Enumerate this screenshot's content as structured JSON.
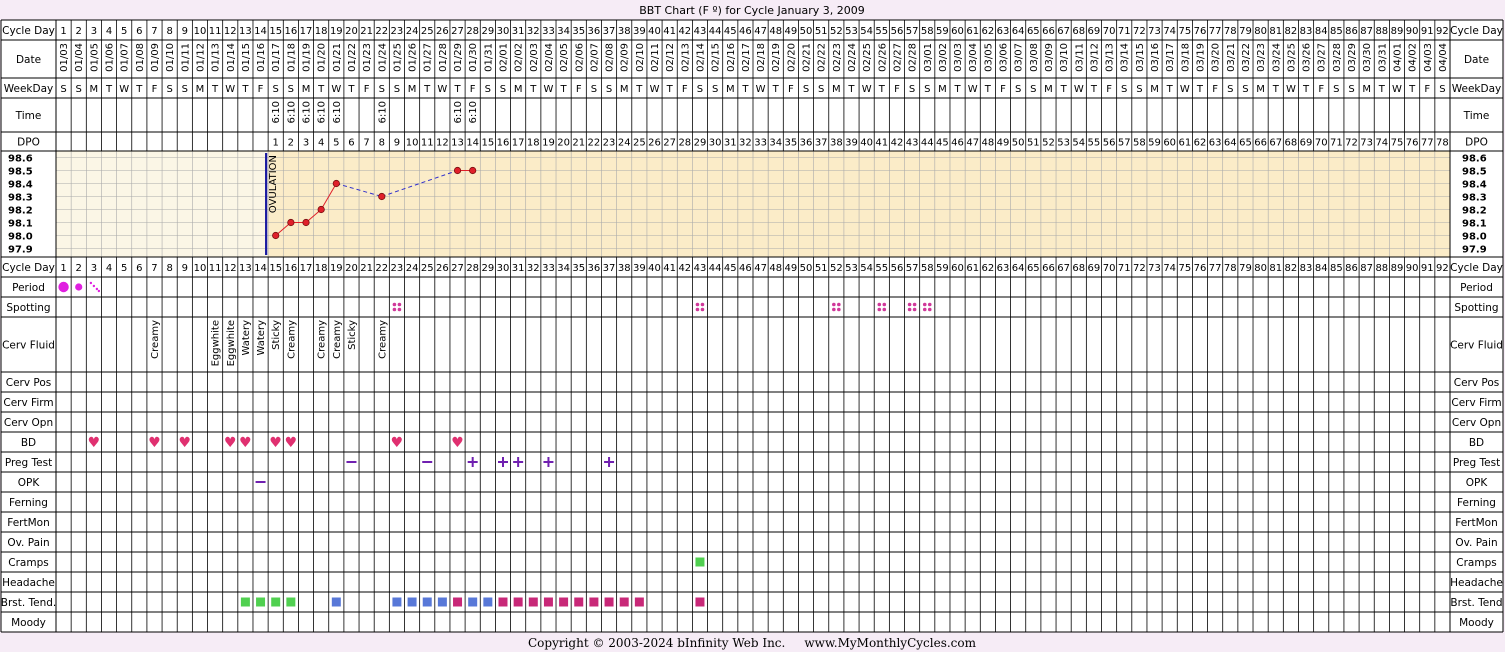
{
  "title": "BBT Chart (F º) for Cycle January 3, 2009",
  "footer": "Copyright © 2003-2024 bInfinity Web Inc.     www.MyMonthlyCycles.com",
  "colors": {
    "page_bg": "#f6ecf6",
    "chart_fill": "#fbecc8",
    "pre_ov_fill": "#fbf6e6",
    "line": "#000000",
    "grid": "#aaaaaa",
    "temp_line": "#e0202a",
    "temp_dash": "#3030cc",
    "ovulation": "#1a1aa0",
    "period": "#e020e0",
    "spotting": "#d0389a",
    "heart": "#e03070",
    "preg_test": "#7020b0",
    "cramps": "#50d050",
    "brst_green": "#50d050",
    "brst_blue": "#5878d8",
    "brst_pink": "#c82878"
  },
  "labels": {
    "cycle_day": "Cycle Day",
    "date": "Date",
    "weekday": "WeekDay",
    "time": "Time",
    "dpo": "DPO",
    "period": "Period",
    "spotting": "Spotting",
    "cerv_fluid": "Cerv Fluid",
    "cerv_pos": "Cerv Pos",
    "cerv_firm": "Cerv Firm",
    "cerv_opn": "Cerv Opn",
    "bd": "BD",
    "preg_test": "Preg Test",
    "opk": "OPK",
    "ferning": "Ferning",
    "fertmon": "FertMon",
    "ov_pain": "Ov. Pain",
    "cramps": "Cramps",
    "headache": "Headache",
    "brst_tend": "Brst. Tend.",
    "moody": "Moody",
    "brst_tend_right": "Brst. Tend",
    "ovulation": "OVULATION"
  },
  "dates": [
    "01/03",
    "01/04",
    "01/05",
    "01/06",
    "01/07",
    "01/08",
    "01/09",
    "01/10",
    "01/11",
    "01/12",
    "01/13",
    "01/14",
    "01/15",
    "01/16",
    "01/17",
    "01/18",
    "01/19",
    "01/20",
    "01/21",
    "01/22",
    "01/23",
    "01/24",
    "01/25",
    "01/26",
    "01/27",
    "01/28",
    "01/29",
    "01/30",
    "01/31",
    "02/01",
    "02/02",
    "02/03",
    "02/04",
    "02/05",
    "02/06",
    "02/07",
    "02/08",
    "02/09",
    "02/10",
    "02/11",
    "02/12",
    "02/13",
    "02/14",
    "02/15",
    "02/16",
    "02/17",
    "02/18",
    "02/19",
    "02/20",
    "02/21",
    "02/22",
    "02/23",
    "02/24",
    "02/25",
    "02/26",
    "02/27",
    "02/28",
    "03/01",
    "03/02",
    "03/03",
    "03/04",
    "03/05",
    "03/06",
    "03/07",
    "03/08",
    "03/09",
    "03/10",
    "03/11",
    "03/12",
    "03/13",
    "03/14",
    "03/15",
    "03/16",
    "03/17",
    "03/18",
    "03/19",
    "03/20",
    "03/21",
    "03/22",
    "03/23",
    "03/24",
    "03/25",
    "03/26",
    "03/27",
    "03/28",
    "03/29",
    "03/30",
    "03/31",
    "04/01",
    "04/02",
    "04/03",
    "04/04"
  ],
  "weekdays": [
    "S",
    "S",
    "M",
    "T",
    "W",
    "T",
    "F",
    "S",
    "S",
    "M",
    "T",
    "W",
    "T",
    "F",
    "S",
    "S",
    "M",
    "T",
    "W",
    "T",
    "F",
    "S",
    "S",
    "M",
    "T",
    "W",
    "T",
    "F",
    "S",
    "S",
    "M",
    "T",
    "W",
    "T",
    "F",
    "S",
    "S",
    "M",
    "T",
    "W",
    "T",
    "F",
    "S",
    "S",
    "M",
    "T",
    "W",
    "T",
    "F",
    "S",
    "S",
    "M",
    "T",
    "W",
    "T",
    "F",
    "S",
    "S",
    "M",
    "T",
    "W",
    "T",
    "F",
    "S",
    "S",
    "M",
    "T",
    "W",
    "T",
    "F",
    "S",
    "S",
    "M",
    "T",
    "W",
    "T",
    "F",
    "S",
    "S",
    "M",
    "T",
    "W",
    "T",
    "F",
    "S",
    "S",
    "M",
    "T",
    "W",
    "T",
    "F",
    "S"
  ],
  "times": [
    {
      "day": 15,
      "t": "6:10"
    },
    {
      "day": 16,
      "t": "6:10"
    },
    {
      "day": 17,
      "t": "6:10"
    },
    {
      "day": 18,
      "t": "6:10"
    },
    {
      "day": 19,
      "t": "6:10"
    },
    {
      "day": 22,
      "t": "6:10"
    },
    {
      "day": 27,
      "t": "6:10"
    },
    {
      "day": 28,
      "t": "6:10"
    }
  ],
  "dpo_start_day": 15,
  "dpo_end": 78,
  "cerv_fluid": [
    {
      "day": 7,
      "v": "Creamy"
    },
    {
      "day": 11,
      "v": "Eggwhite"
    },
    {
      "day": 12,
      "v": "Eggwhite"
    },
    {
      "day": 13,
      "v": "Watery"
    },
    {
      "day": 14,
      "v": "Watery"
    },
    {
      "day": 15,
      "v": "Sticky"
    },
    {
      "day": 16,
      "v": "Creamy"
    },
    {
      "day": 18,
      "v": "Creamy"
    },
    {
      "day": 19,
      "v": "Creamy"
    },
    {
      "day": 20,
      "v": "Sticky"
    },
    {
      "day": 22,
      "v": "Creamy"
    }
  ],
  "period": [
    {
      "day": 1,
      "level": "heavy"
    },
    {
      "day": 2,
      "level": "medium"
    },
    {
      "day": 3,
      "level": "spotting"
    }
  ],
  "spotting_days": [
    23,
    43,
    52,
    55,
    57,
    58
  ],
  "bd_days": [
    3,
    7,
    9,
    12,
    13,
    15,
    16,
    23,
    27
  ],
  "preg_tests": [
    {
      "day": 20,
      "r": "neg"
    },
    {
      "day": 25,
      "r": "neg"
    },
    {
      "day": 28,
      "r": "pos"
    },
    {
      "day": 30,
      "r": "pos"
    },
    {
      "day": 31,
      "r": "pos"
    },
    {
      "day": 33,
      "r": "pos"
    },
    {
      "day": 37,
      "r": "pos"
    }
  ],
  "opk": [
    {
      "day": 14,
      "r": "neg"
    }
  ],
  "cramps_days": [
    43
  ],
  "brst_tend": [
    {
      "day": 13,
      "c": "green"
    },
    {
      "day": 14,
      "c": "green"
    },
    {
      "day": 15,
      "c": "green"
    },
    {
      "day": 16,
      "c": "green"
    },
    {
      "day": 19,
      "c": "blue"
    },
    {
      "day": 23,
      "c": "blue"
    },
    {
      "day": 24,
      "c": "blue"
    },
    {
      "day": 25,
      "c": "blue"
    },
    {
      "day": 26,
      "c": "blue"
    },
    {
      "day": 27,
      "c": "pink"
    },
    {
      "day": 28,
      "c": "blue"
    },
    {
      "day": 29,
      "c": "blue"
    },
    {
      "day": 30,
      "c": "pink"
    },
    {
      "day": 31,
      "c": "pink"
    },
    {
      "day": 32,
      "c": "pink"
    },
    {
      "day": 33,
      "c": "pink"
    },
    {
      "day": 34,
      "c": "pink"
    },
    {
      "day": 35,
      "c": "pink"
    },
    {
      "day": 36,
      "c": "pink"
    },
    {
      "day": 37,
      "c": "pink"
    },
    {
      "day": 38,
      "c": "pink"
    },
    {
      "day": 39,
      "c": "pink"
    },
    {
      "day": 43,
      "c": "pink"
    }
  ],
  "chart_data": {
    "type": "line",
    "title": "BBT Chart (F º) for Cycle January 3, 2009",
    "xlabel": "Cycle Day",
    "ylabel": "",
    "ylim": [
      97.9,
      98.6
    ],
    "y_ticks": [
      "98.6",
      "98.5",
      "98.4",
      "98.3",
      "98.2",
      "98.1",
      "98.0",
      "97.9"
    ],
    "x": [
      15,
      16,
      17,
      18,
      19,
      22,
      27,
      28
    ],
    "values": [
      98.0,
      98.1,
      98.1,
      98.2,
      98.4,
      98.3,
      98.5,
      98.5
    ],
    "connection": [
      "solid",
      "solid",
      "solid",
      "solid",
      "dashed",
      "dashed",
      "solid"
    ],
    "ovulation_day": 14,
    "grid": true
  }
}
